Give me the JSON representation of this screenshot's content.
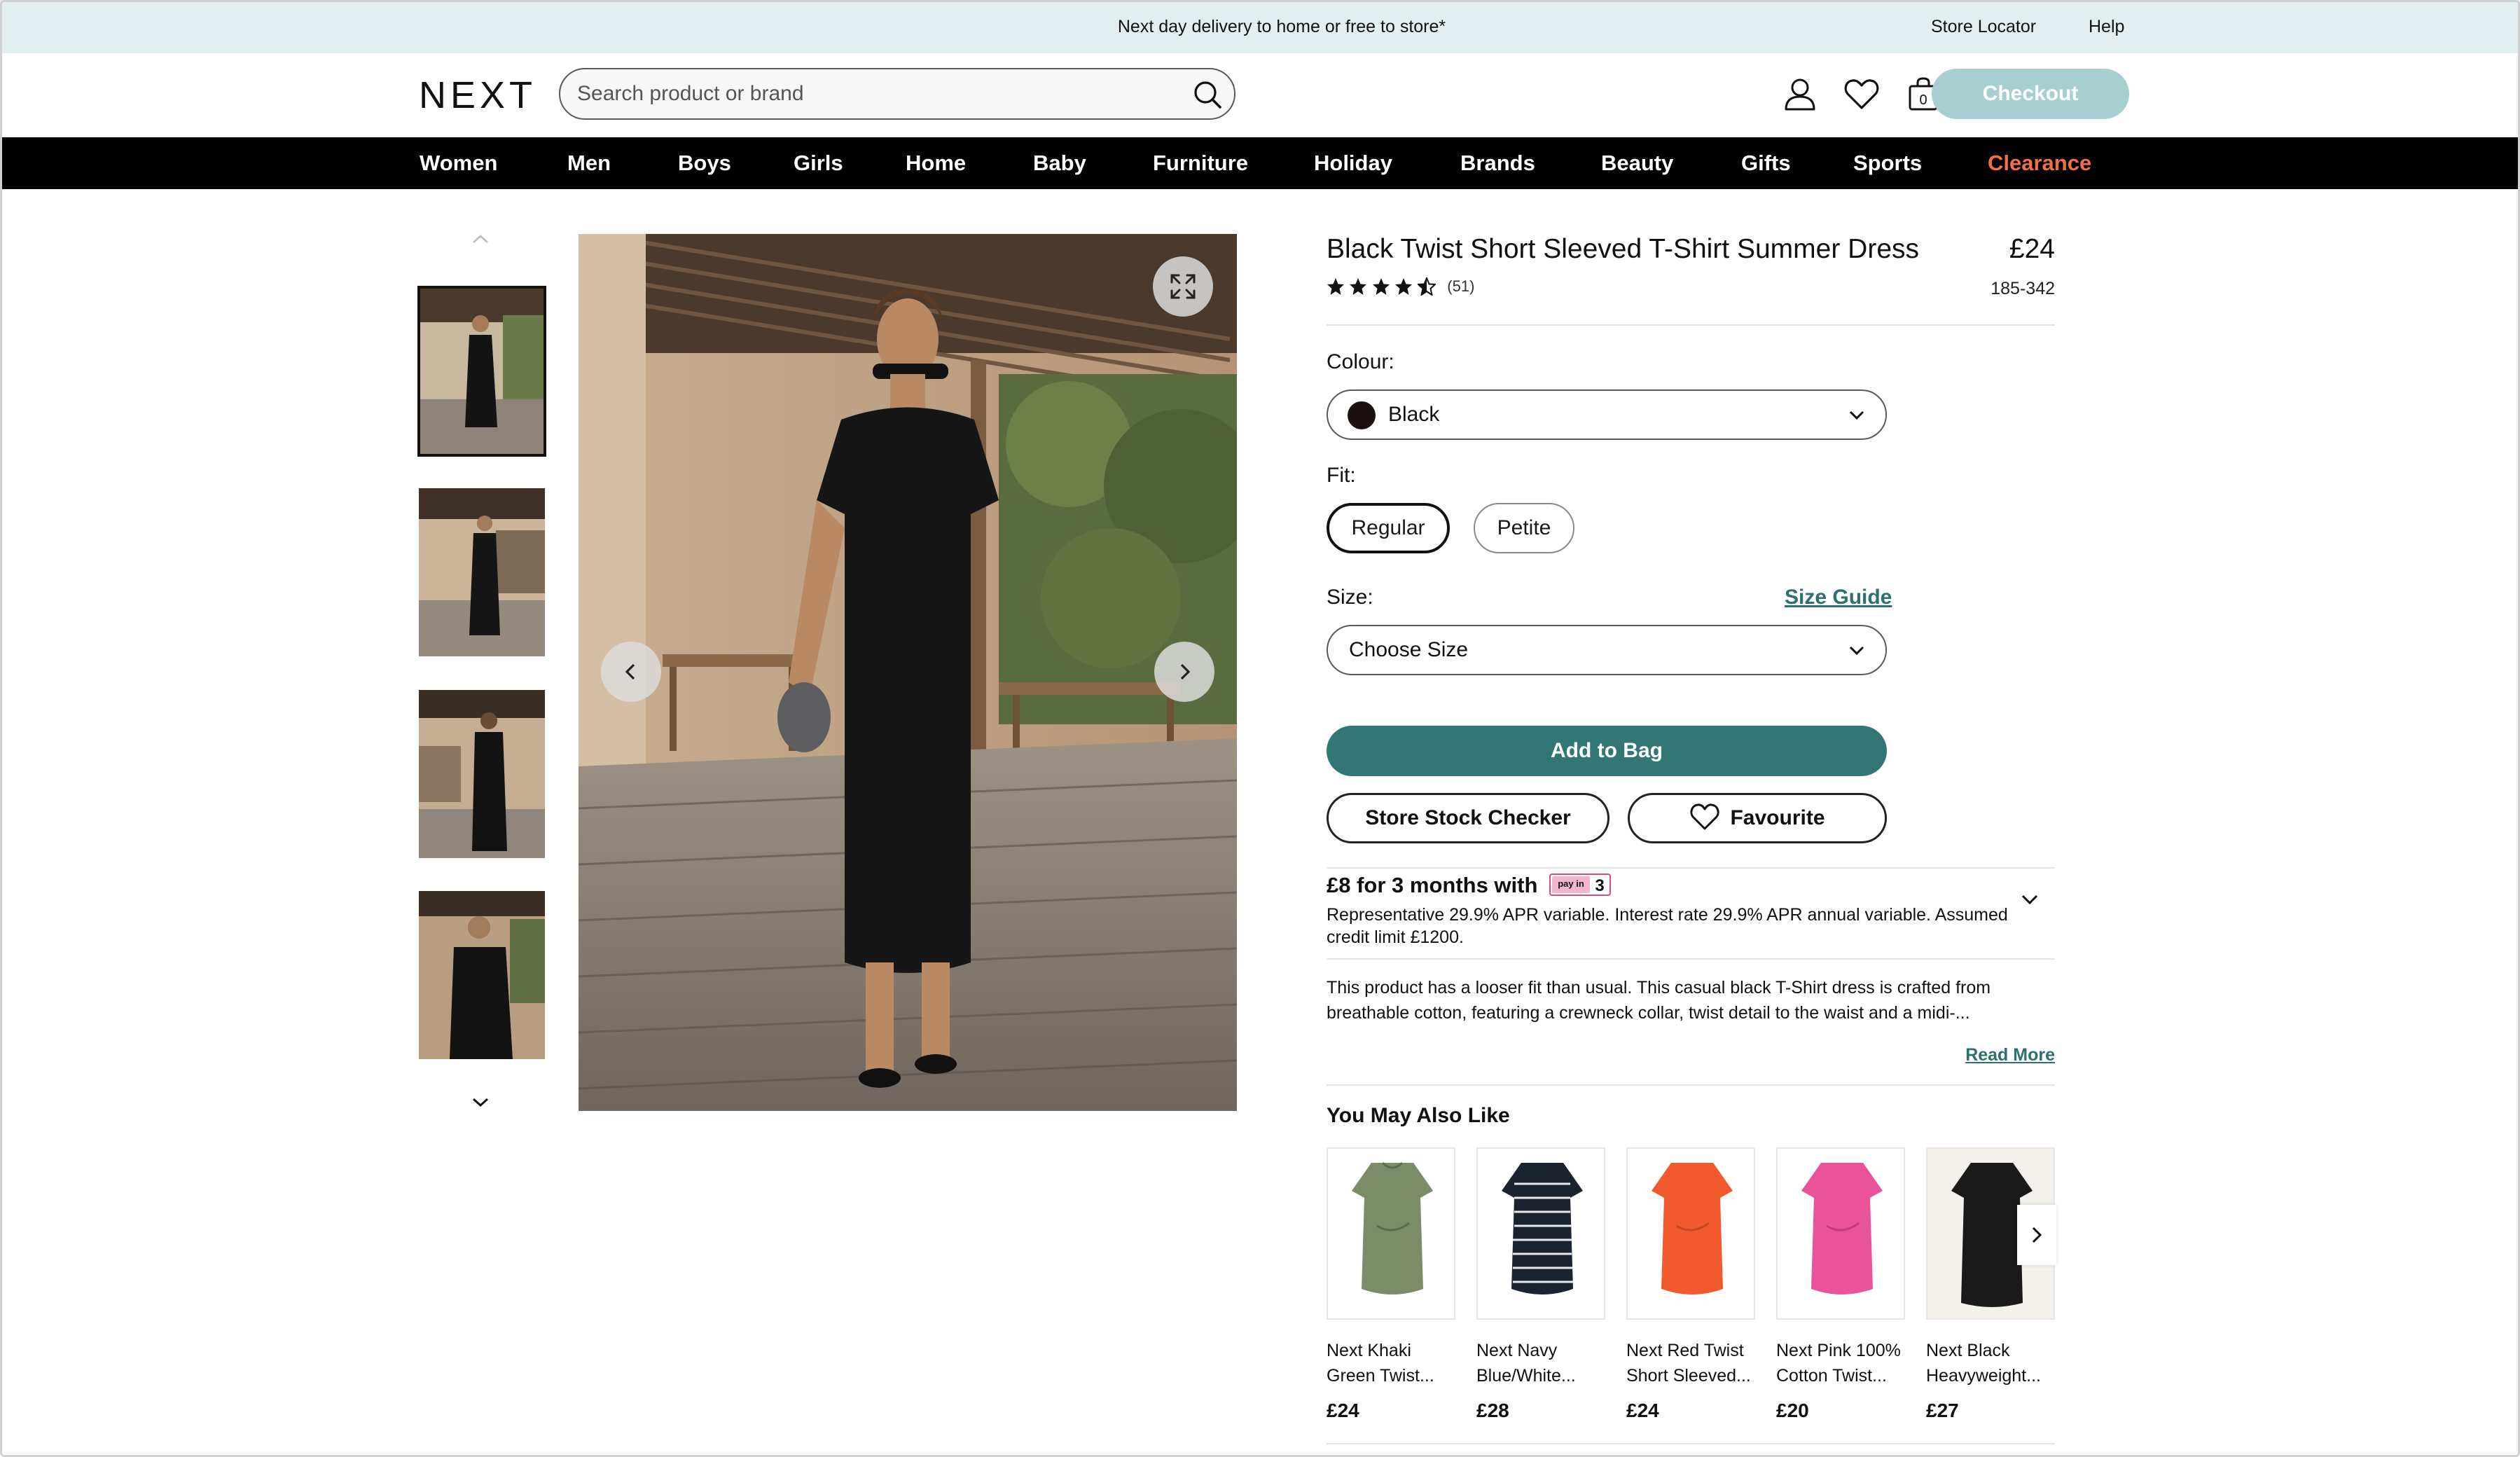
{
  "promo": {
    "message": "Next day delivery to home or free to store*",
    "store_locator": "Store Locator",
    "help": "Help"
  },
  "header": {
    "logo": "NEXT",
    "search_placeholder": "Search product or brand",
    "checkout": "Checkout",
    "icons": [
      "account-icon",
      "heart-icon",
      "bag-icon",
      "search-icon"
    ],
    "bag_count": "0"
  },
  "nav": {
    "items": [
      "Women",
      "Men",
      "Boys",
      "Girls",
      "Home",
      "Baby",
      "Furniture",
      "Holiday",
      "Brands",
      "Beauty",
      "Gifts",
      "Sports",
      "Clearance"
    ]
  },
  "product": {
    "title": "Black Twist Short Sleeved T-Shirt Summer Dress",
    "price": "£24",
    "rating": 4.5,
    "review_count": "(51)",
    "item_code": "185-342",
    "colour_label": "Colour:",
    "colour_value": "Black",
    "fit_label": "Fit:",
    "fit_options": [
      "Regular",
      "Petite"
    ],
    "fit_selected": "Regular",
    "size_label": "Size:",
    "size_guide": "Size Guide",
    "size_placeholder": "Choose Size",
    "add_to_bag": "Add to Bag",
    "store_stock": "Store Stock Checker",
    "favourite": "Favourite"
  },
  "finance": {
    "title": "£8 for 3 months with",
    "badge_text": "3",
    "badge_small": "pay in",
    "text": "Representative 29.9% APR variable. Interest rate 29.9% APR annual variable. Assumed credit limit £1200."
  },
  "description": {
    "text": "This product has a looser fit than usual. This casual black T-Shirt dress is crafted from breathable cotton, featuring a crewneck collar, twist detail to the waist and a midi-...",
    "read_more": "Read More"
  },
  "recommendations": {
    "title": "You May Also Like",
    "items": [
      {
        "name": "Next Khaki Green Twist...",
        "price": "£24",
        "color": "#7c8c68"
      },
      {
        "name": "Next Navy Blue/White...",
        "price": "£28",
        "color": "#1b2230"
      },
      {
        "name": "Next Red Twist Short Sleeved...",
        "price": "£24",
        "color": "#f05a2c"
      },
      {
        "name": "Next Pink 100% Cotton Twist...",
        "price": "£20",
        "color": "#e8539a"
      },
      {
        "name": "Next Black Heavyweight...",
        "price": "£27",
        "color": "#1a1a1a"
      }
    ]
  },
  "colors": {
    "accent": "#327675",
    "checkout": "#a7cfd2",
    "promo_bg": "#e2eff0",
    "clearance": "#f26f4b"
  }
}
